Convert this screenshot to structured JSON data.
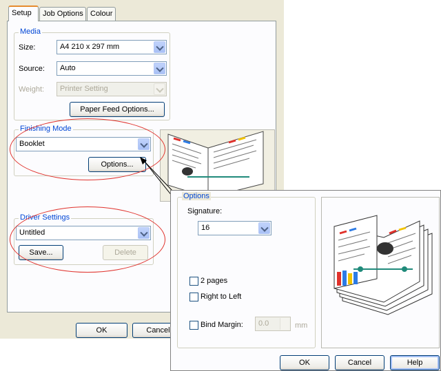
{
  "tabs": [
    {
      "label": "Setup"
    },
    {
      "label": "Job Options"
    },
    {
      "label": "Colour"
    }
  ],
  "media": {
    "title": "Media",
    "size_label": "Size:",
    "size_value": "A4 210 x 297 mm",
    "source_label": "Source:",
    "source_value": "Auto",
    "weight_label": "Weight:",
    "weight_value": "Printer Setting",
    "paper_feed_button": "Paper Feed Options..."
  },
  "finishing": {
    "title": "Finishing Mode",
    "mode_value": "Booklet",
    "options_button": "Options..."
  },
  "driver": {
    "title": "Driver Settings",
    "value": "Untitled",
    "save_button": "Save...",
    "delete_button": "Delete"
  },
  "footer": {
    "ok": "OK",
    "cancel": "Cancel"
  },
  "options_dialog": {
    "title": "Options",
    "signature_label": "Signature:",
    "signature_value": "16",
    "two_pages": "2 pages",
    "right_to_left": "Right to Left",
    "bind_margin": "Bind Margin:",
    "bind_margin_value": "0.0",
    "unit": "mm",
    "ok": "OK",
    "cancel": "Cancel",
    "help": "Help"
  },
  "colors": {
    "accent": "#0046d5",
    "highlight": "#e0312b"
  }
}
